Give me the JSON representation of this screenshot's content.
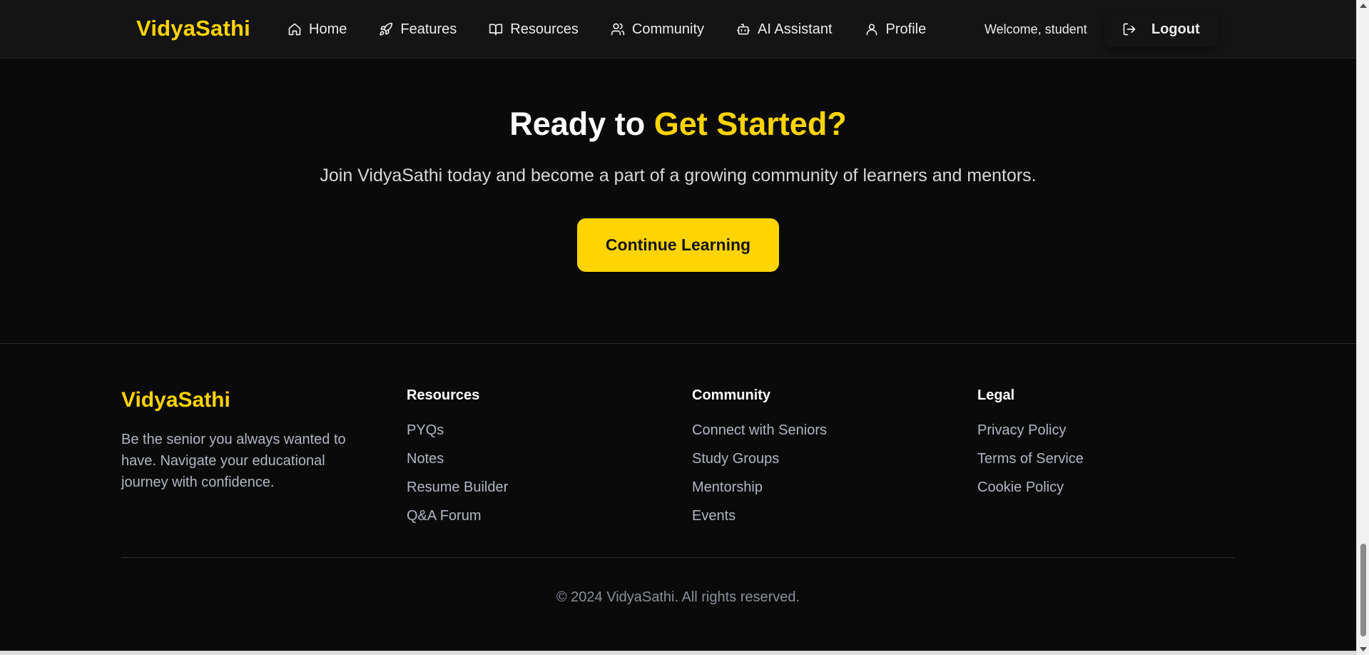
{
  "nav": {
    "brand": "VidyaSathi",
    "items": [
      {
        "label": "Home",
        "icon": "home-icon"
      },
      {
        "label": "Features",
        "icon": "rocket-icon"
      },
      {
        "label": "Resources",
        "icon": "book-open-icon"
      },
      {
        "label": "Community",
        "icon": "users-icon"
      },
      {
        "label": "AI Assistant",
        "icon": "bot-icon"
      },
      {
        "label": "Profile",
        "icon": "user-icon"
      }
    ],
    "welcome": "Welcome, student",
    "logout_label": "Logout",
    "logout_icon": "logout-icon"
  },
  "hero": {
    "title_prefix": "Ready to ",
    "title_accent": "Get Started?",
    "subtitle": "Join VidyaSathi today and become a part of a growing community of learners and mentors.",
    "cta_label": "Continue Learning"
  },
  "footer": {
    "brand": "VidyaSathi",
    "tagline": "Be the senior you always wanted to have. Navigate your educational journey with confidence.",
    "columns": [
      {
        "heading": "Resources",
        "links": [
          "PYQs",
          "Notes",
          "Resume Builder",
          "Q&A Forum"
        ]
      },
      {
        "heading": "Community",
        "links": [
          "Connect with Seniors",
          "Study Groups",
          "Mentorship",
          "Events"
        ]
      },
      {
        "heading": "Legal",
        "links": [
          "Privacy Policy",
          "Terms of Service",
          "Cookie Policy"
        ]
      }
    ],
    "copyright": "© 2024 VidyaSathi. All rights reserved."
  },
  "colors": {
    "accent": "#FFD400",
    "background": "#0a0a0a",
    "navbar": "#141414",
    "muted_text": "#b0b6c2"
  }
}
